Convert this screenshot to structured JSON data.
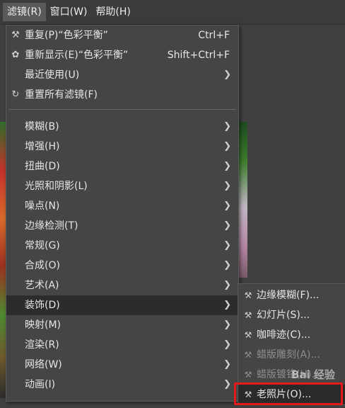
{
  "menubar": {
    "items": [
      {
        "label": "滤镜(R)"
      },
      {
        "label": "窗口(W)"
      },
      {
        "label": "帮助(H)"
      }
    ]
  },
  "filters_menu": {
    "top": [
      {
        "label": "重复(P)“色彩平衡”",
        "shortcut": "Ctrl+F",
        "icon": "repeat-icon"
      },
      {
        "label": "重新显示(E)“色彩平衡”",
        "shortcut": "Shift+Ctrl+F",
        "icon": "reshow-icon"
      },
      {
        "label": "最近使用(U)",
        "icon": ""
      },
      {
        "label": "重置所有滤镜(F)",
        "icon": "reset-icon"
      }
    ],
    "categories": [
      {
        "label": "模糊(B)"
      },
      {
        "label": "增强(H)"
      },
      {
        "label": "扭曲(D)"
      },
      {
        "label": "光照和阴影(L)"
      },
      {
        "label": "噪点(N)"
      },
      {
        "label": "边缘检测(T)"
      },
      {
        "label": "常规(G)"
      },
      {
        "label": "合成(O)"
      },
      {
        "label": "艺术(A)"
      },
      {
        "label": "装饰(D)"
      },
      {
        "label": "映射(M)"
      },
      {
        "label": "渲染(R)"
      },
      {
        "label": "网络(W)"
      },
      {
        "label": "动画(I)"
      }
    ],
    "highlighted": "装饰(D)"
  },
  "decor_submenu": {
    "items": [
      {
        "label": "边缘模糊(F)...",
        "enabled": true
      },
      {
        "label": "幻灯片(S)...",
        "enabled": true
      },
      {
        "label": "咖啡迹(C)...",
        "enabled": true
      },
      {
        "label": "蜡版雕刻(A)...",
        "enabled": false
      },
      {
        "label": "蜡版镀铬(H)...",
        "enabled": false
      },
      {
        "label": "老照片(O)...",
        "enabled": true
      }
    ],
    "highlighted": "老照片(O)..."
  },
  "watermark": "Bai 经验",
  "colors": {
    "highlight_box": "#e11a1a",
    "menu_bg": "#454545"
  }
}
